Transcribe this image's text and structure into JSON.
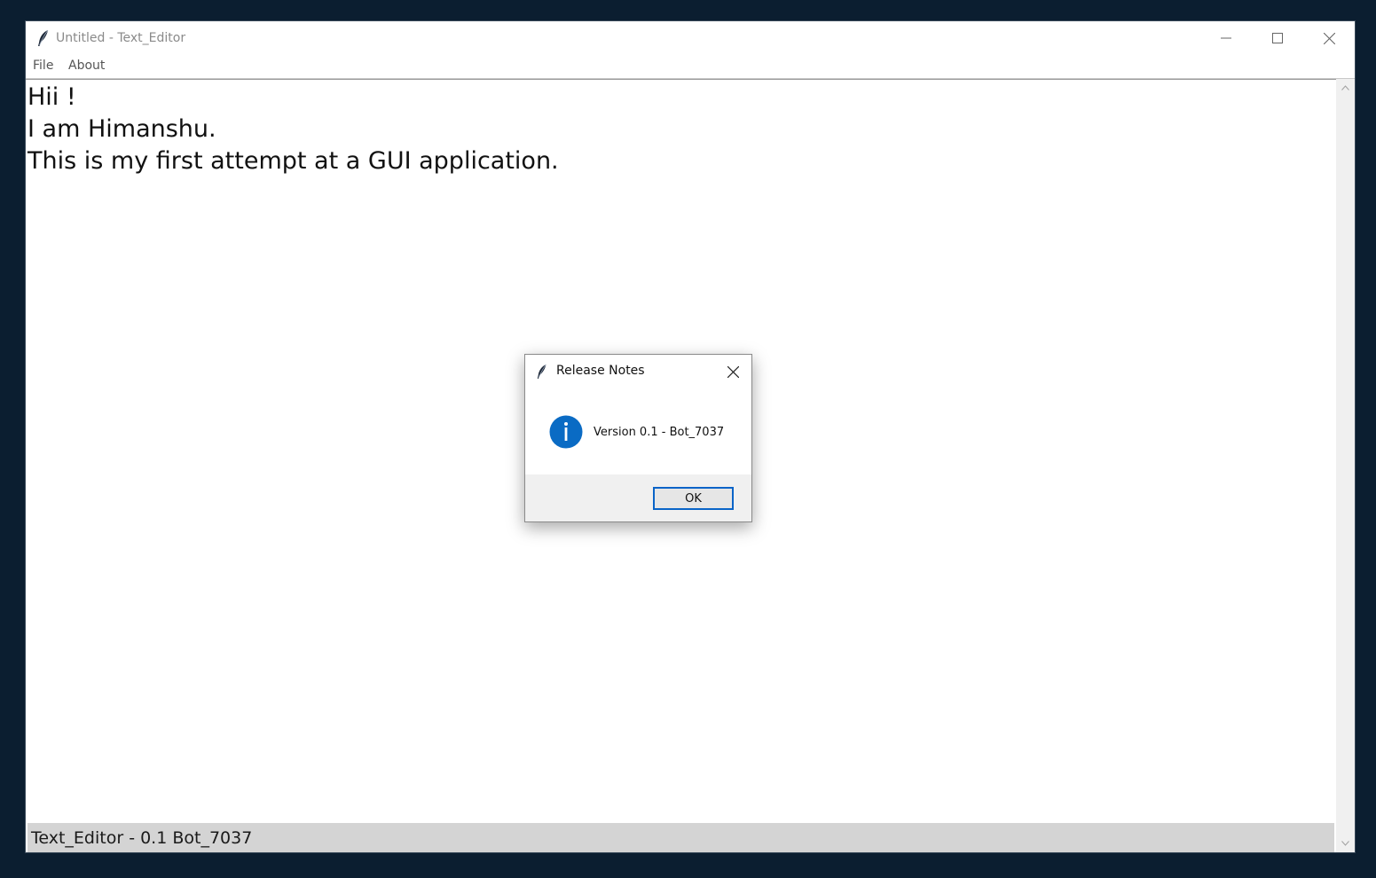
{
  "window": {
    "title": "Untitled - Text_Editor",
    "icon": "feather-icon"
  },
  "menubar": {
    "items": [
      {
        "label": "File"
      },
      {
        "label": "About"
      }
    ]
  },
  "editor": {
    "lines": [
      "Hii !",
      "I am Himanshu.",
      "This is my first attempt at a GUI application."
    ]
  },
  "statusbar": {
    "text": "Text_Editor - 0.1 Bot_7037"
  },
  "dialog": {
    "title": "Release Notes",
    "icon": "info-icon",
    "message": "Version 0.1 - Bot_7037",
    "ok_label": "OK"
  },
  "colors": {
    "desktop": "#0b1e30",
    "info_blue": "#0a6bc4",
    "focus_border": "#0a64c8",
    "statusbar": "#d4d4d4"
  }
}
